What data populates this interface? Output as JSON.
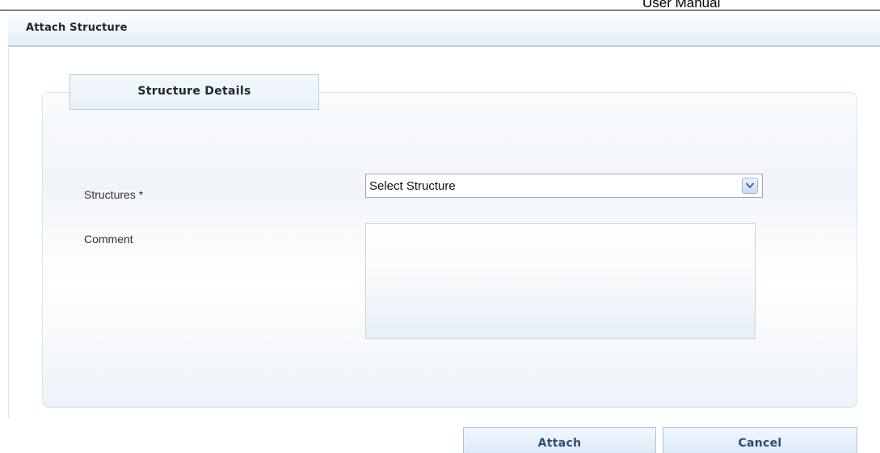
{
  "document": {
    "header_text": "User Manual"
  },
  "dialog": {
    "title": "Attach Structure"
  },
  "section": {
    "tab_label": "Structure Details"
  },
  "form": {
    "structures_label": "Structures *",
    "structures_selected": "Select Structure",
    "comment_label": "Comment",
    "comment_value": ""
  },
  "actions": {
    "attach_label": "Attach",
    "cancel_label": "Cancel"
  },
  "icons": {
    "dropdown": "chevron-down-icon"
  },
  "colors": {
    "title_bar_border": "#b8cfe6",
    "button_text": "#2a4f7a",
    "panel_border": "#dbe5ef"
  }
}
